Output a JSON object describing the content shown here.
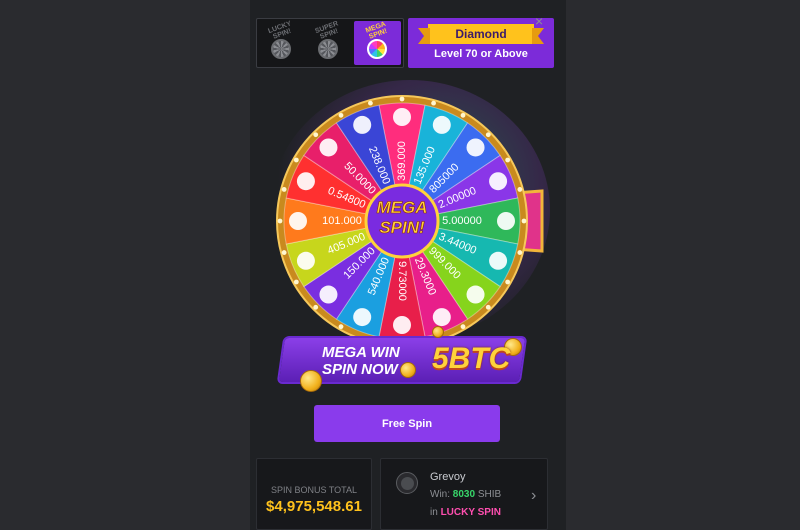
{
  "tabs": [
    {
      "label": "LUCKY SPIN!",
      "active": false
    },
    {
      "label": "SUPER SPIN!",
      "active": false
    },
    {
      "label": "MEGA SPIN!",
      "active": true
    }
  ],
  "promo": {
    "title": "Diamond",
    "subtitle": "Level 70 or Above"
  },
  "close_symbol": "×",
  "wheel": {
    "center_line1": "MEGA",
    "center_line2": "SPIN!",
    "segments": [
      {
        "value": "369.000",
        "color": "#ff2d7d",
        "icon": "tron-icon"
      },
      {
        "value": "135.000",
        "color": "#19b3d9",
        "icon": "cardano-icon"
      },
      {
        "value": "805000",
        "color": "#3b6cf0",
        "icon": "shib-icon"
      },
      {
        "value": "2.00000",
        "color": "#8a36e8",
        "icon": "c-coin-icon"
      },
      {
        "value": "5.00000",
        "color": "#2fb85a",
        "icon": "bitcoin-icon"
      },
      {
        "value": "3.44000",
        "color": "#16b8b0",
        "icon": "binance-icon"
      },
      {
        "value": "999.000",
        "color": "#86d41c",
        "icon": "binance-icon"
      },
      {
        "value": "29.3000",
        "color": "#e81f8a",
        "icon": "c-coin-icon"
      },
      {
        "value": "9.73000",
        "color": "#e81f4a",
        "icon": "tron-icon"
      },
      {
        "value": "540.000",
        "color": "#1b9fe0",
        "icon": "usdc-icon"
      },
      {
        "value": "150.000",
        "color": "#7a2ee0",
        "icon": "xrp-icon"
      },
      {
        "value": "405.000",
        "color": "#c7d61c",
        "icon": "xrp-icon"
      },
      {
        "value": "101.000",
        "color": "#ff7a1c",
        "icon": "polygon-icon"
      },
      {
        "value": "0.54800",
        "color": "#ff3030",
        "icon": "litecoin-icon"
      },
      {
        "value": "50.0000",
        "color": "#e81f6a",
        "icon": "c-coin-icon"
      },
      {
        "value": "238.000",
        "color": "#3a45d6",
        "icon": "eth-icon"
      }
    ]
  },
  "banner": {
    "line1": "MEGA WIN",
    "line2": "SPIN NOW",
    "prize": "5BTC"
  },
  "free_spin_label": "Free Spin",
  "bonus": {
    "label": "SPIN BONUS TOTAL",
    "value": "$4,975,548.61"
  },
  "winner": {
    "name": "Grevoy",
    "win_prefix": "Win:",
    "amount": "8030",
    "currency": "SHIB",
    "game_prefix": "in",
    "game": "LUCKY SPIN"
  },
  "colors": {
    "accent": "#8a3bec",
    "gold": "#ffc21c",
    "panel": "#1f2124"
  }
}
